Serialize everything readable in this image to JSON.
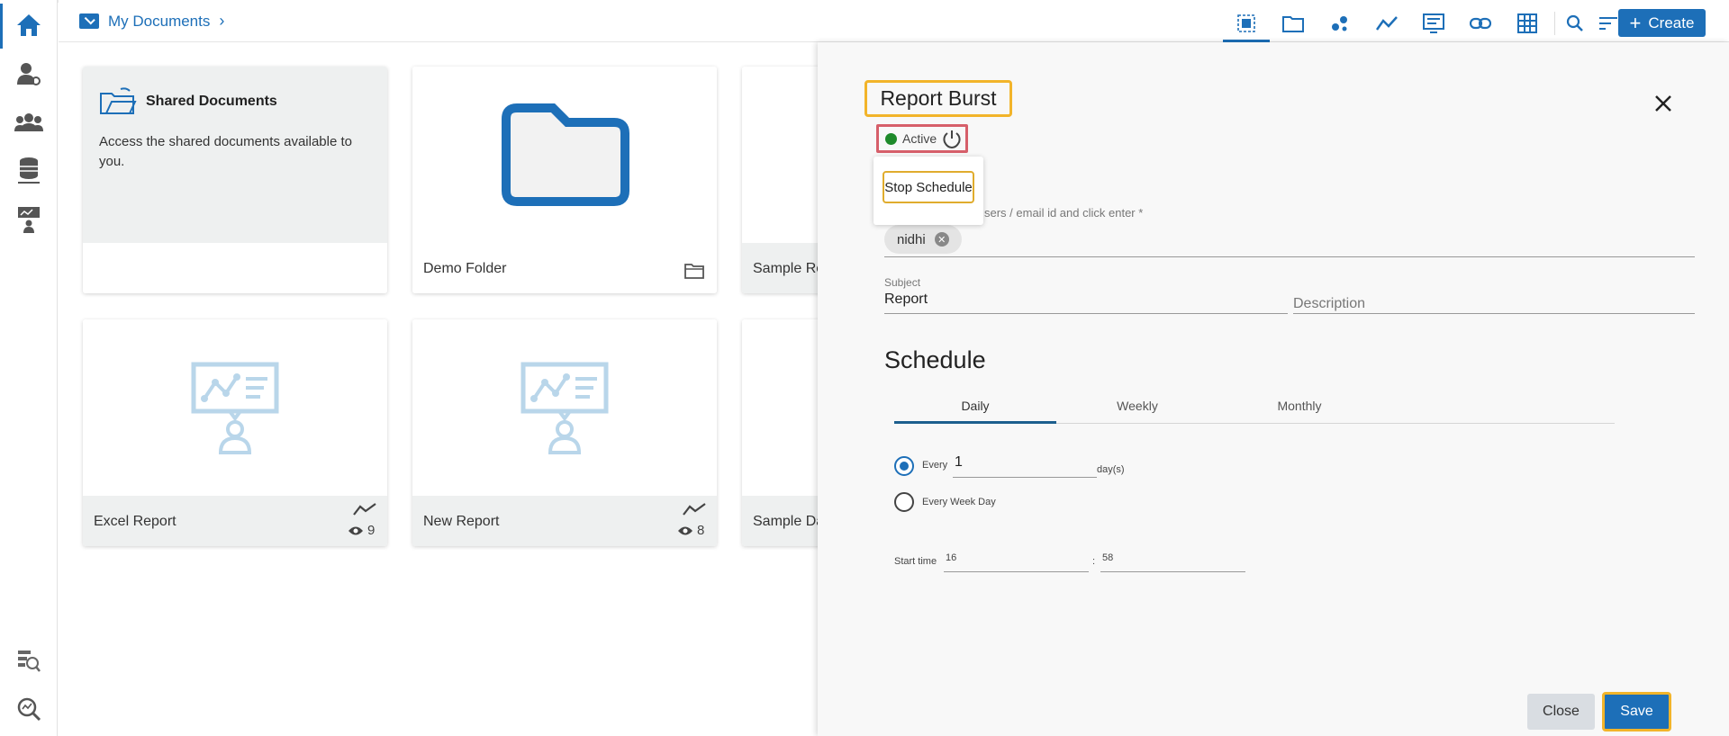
{
  "breadcrumb": {
    "label": "My Documents"
  },
  "toolbar": {
    "create_label": "Create"
  },
  "cards": {
    "shared": {
      "title": "Shared Documents",
      "description": "Access the shared documents available to you."
    },
    "demo_folder": {
      "name": "Demo Folder"
    },
    "sample_report": {
      "name": "Sample Re"
    },
    "excel_report": {
      "name": "Excel Report",
      "views": "9"
    },
    "new_report": {
      "name": "New Report",
      "views": "8"
    },
    "sample_dashboard": {
      "name": "Sample Da"
    }
  },
  "drawer": {
    "title": "Report Burst",
    "status": "Active",
    "popover_action": "Stop Schedule",
    "recipients_label": "sers / email id and click enter *",
    "recipient_chip": "nidhi",
    "subject_label": "Subject",
    "subject_value": "Report",
    "description_placeholder": "Description",
    "schedule_title": "Schedule",
    "tabs": [
      "Daily",
      "Weekly",
      "Monthly"
    ],
    "every_label": "Every",
    "every_value": "1",
    "every_unit": "day(s)",
    "every_week_day_label": "Every Week Day",
    "start_time_label": "Start time",
    "start_hour": "16",
    "time_sep": ":",
    "start_minute": "58",
    "close_label": "Close",
    "save_label": "Save"
  },
  "colors": {
    "accent": "#1d6fb8",
    "highlight": "#f2b42a",
    "status_active": "#1e8a2a"
  }
}
